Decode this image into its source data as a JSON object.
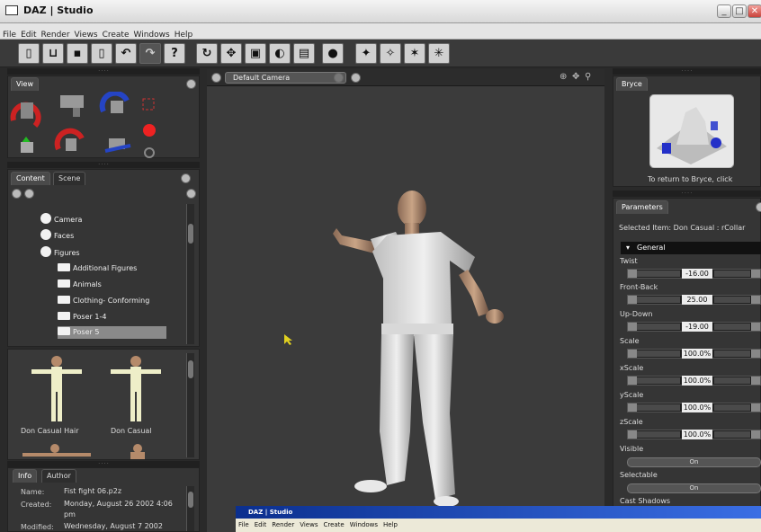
{
  "window": {
    "title": "DAZ | Studio",
    "min": "_",
    "max": "□",
    "close": "✕"
  },
  "menu": [
    "File",
    "Edit",
    "Render",
    "Views",
    "Create",
    "Windows",
    "Help"
  ],
  "toolbar": {
    "help_glyph": "?"
  },
  "view_panel": {
    "tab": "View"
  },
  "content_panel": {
    "tabs": [
      "Content",
      "Scene"
    ],
    "tree": [
      "Camera",
      "Faces",
      "Figures",
      "Additional Figures",
      "Animals",
      "Clothing- Conforming",
      "Poser 1-4",
      "Poser 5"
    ],
    "thumbs": [
      "Don Casual Hair",
      "Don Casual"
    ]
  },
  "info_panel": {
    "tabs": [
      "Info",
      "Author"
    ],
    "rows": [
      {
        "key": "Name:",
        "value": "Fist fight 06.p2z"
      },
      {
        "key": "Created:",
        "value": "Monday, August 26 2002 4:06 pm"
      },
      {
        "key": "Modified:",
        "value": "Wednesday, August 7 2002"
      }
    ]
  },
  "viewport": {
    "camera": "Default Camera"
  },
  "bryce_panel": {
    "tab": "Bryce",
    "caption": "To return to Bryce, click"
  },
  "parameters": {
    "tab": "Parameters",
    "selected": "Selected Item:  Don Casual  : rCollar",
    "group": "General",
    "sliders": [
      {
        "label": "Twist",
        "value": "-16.00"
      },
      {
        "label": "Front-Back",
        "value": "25.00"
      },
      {
        "label": "Up-Down",
        "value": "-19.00"
      },
      {
        "label": "Scale",
        "value": "100.0%"
      },
      {
        "label": "xScale",
        "value": "100.0%"
      },
      {
        "label": "yScale",
        "value": "100.0%"
      },
      {
        "label": "zScale",
        "value": "100.0%"
      }
    ],
    "toggles": [
      {
        "label": "Visible",
        "value": "On"
      },
      {
        "label": "Selectable",
        "value": "On"
      }
    ],
    "last_label": "Cast Shadows"
  },
  "second_window": {
    "title": "DAZ | Studio",
    "menu": [
      "File",
      "Edit",
      "Render",
      "Views",
      "Create",
      "Windows",
      "Help"
    ]
  }
}
